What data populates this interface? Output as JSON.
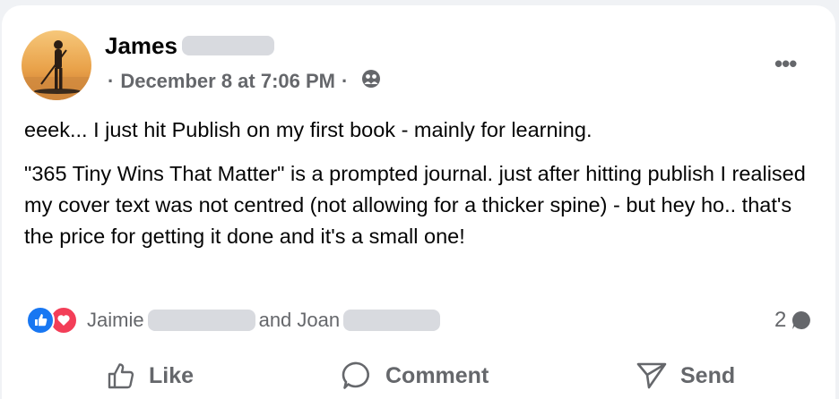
{
  "post": {
    "author_first_name": "James",
    "date": "December 8 at 7:06 PM",
    "separator": "·",
    "audience_icon": "friends-icon",
    "more_label": "•••",
    "paragraphs": [
      "eeek...  I just hit Publish on  my first book - mainly for learning.",
      "\"365 Tiny Wins That Matter\" is a prompted journal. just after hitting publish I realised my cover text was not centred  (not allowing for a thicker spine) - but hey ho.. that's the price for getting it done and it's a small one!"
    ],
    "reactions": {
      "icons": [
        "like-reaction-icon",
        "love-reaction-icon"
      ],
      "name1": "Jaimie",
      "connector": "and Joan"
    },
    "comment_count": "2",
    "actions": {
      "like": "Like",
      "comment": "Comment",
      "send": "Send"
    }
  },
  "colors": {
    "like_blue": "#1877f2",
    "love_red": "#f33e58",
    "secondary_text": "#65676b",
    "background": "#f0f2f5"
  }
}
